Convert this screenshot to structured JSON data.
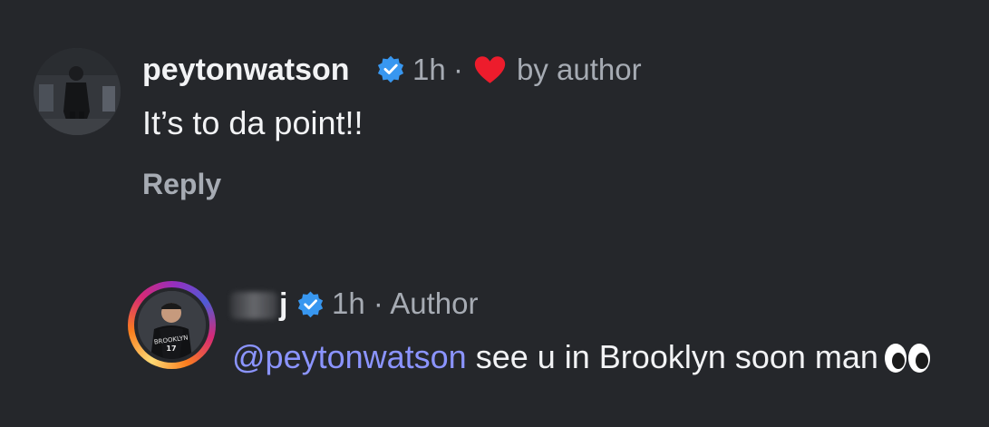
{
  "comment": {
    "username": "peytonwatson",
    "time": "1h",
    "separator": "·",
    "liked_by_author_label": "by author",
    "text": "It’s to da point!!",
    "reply_label": "Reply",
    "icons": {
      "verified": "verified-badge-icon",
      "heart": "heart-icon"
    },
    "colors": {
      "verified": "#3897f0",
      "heart": "#ed1c2c"
    }
  },
  "reply": {
    "username_visible": "j",
    "time_label": "1h · Author",
    "mention": "@peytonwatson",
    "text": " see u in Brooklyn soon man",
    "emoji_icon": "eyes-emoji-icon",
    "colors": {
      "mention": "#8b94ff",
      "story_ring": "#d62976"
    }
  }
}
